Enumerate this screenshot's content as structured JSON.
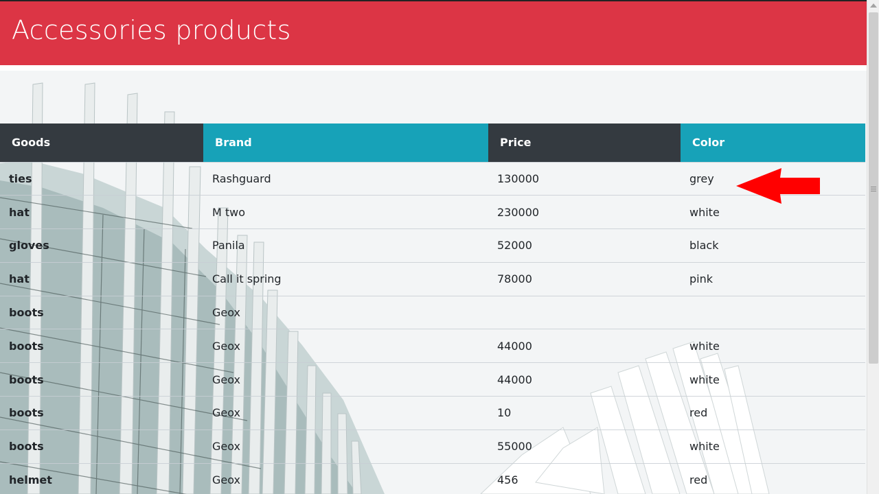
{
  "header": {
    "title": "Accessories products",
    "background_color": "#dc3545"
  },
  "table": {
    "columns": [
      "Goods",
      "Brand",
      "Price",
      "Color"
    ],
    "header_colors": [
      "#343a40",
      "#17a2b8",
      "#343a40",
      "#17a2b8"
    ],
    "rows": [
      {
        "goods": "ties",
        "brand": "Rashguard",
        "price": "130000",
        "color": "grey"
      },
      {
        "goods": "hat",
        "brand": "M two",
        "price": "230000",
        "color": "white"
      },
      {
        "goods": "gloves",
        "brand": "Panila",
        "price": "52000",
        "color": "black"
      },
      {
        "goods": "hat",
        "brand": "Call it spring",
        "price": "78000",
        "color": "pink"
      },
      {
        "goods": "boots",
        "brand": "Geox",
        "price": "",
        "color": ""
      },
      {
        "goods": "boots",
        "brand": "Geox",
        "price": "44000",
        "color": "white"
      },
      {
        "goods": "boots",
        "brand": "Geox",
        "price": "44000",
        "color": "white"
      },
      {
        "goods": "boots",
        "brand": "Geox",
        "price": "10",
        "color": "red"
      },
      {
        "goods": "boots",
        "brand": "Geox",
        "price": "55000",
        "color": "white"
      },
      {
        "goods": "helmet",
        "brand": "Geox",
        "price": "456",
        "color": "red"
      }
    ]
  },
  "annotation": {
    "icon": "red-arrow-left-icon",
    "color": "#ff0000"
  }
}
